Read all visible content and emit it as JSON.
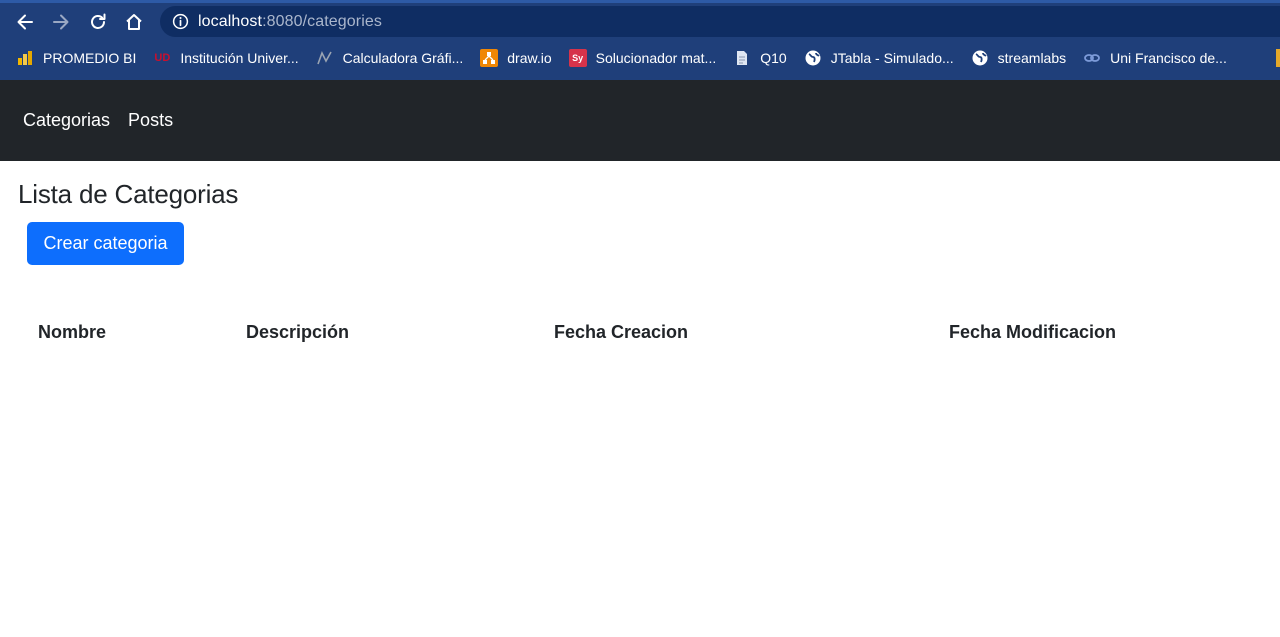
{
  "browser": {
    "url_host": "localhost",
    "url_path": ":8080/categories",
    "bookmarks": [
      {
        "label": "PROMEDIO BI",
        "icon": "bar-chart-icon",
        "color": "#f2b600"
      },
      {
        "label": "Institución Univer...",
        "icon": "university-logo-icon",
        "color": "#c8102e"
      },
      {
        "label": "Calculadora Gráfi...",
        "icon": "graph-icon",
        "color": "#9aa4b2"
      },
      {
        "label": "draw.io",
        "icon": "drawio-icon",
        "color": "#f08705"
      },
      {
        "label": "Solucionador mat...",
        "icon": "symbolab-icon",
        "color": "#d6334b"
      },
      {
        "label": "Q10",
        "icon": "document-icon",
        "color": "#dfe6f2"
      },
      {
        "label": "JTabla - Simulado...",
        "icon": "globe-icon",
        "color": "#ffffff"
      },
      {
        "label": "streamlabs",
        "icon": "globe-icon",
        "color": "#ffffff"
      },
      {
        "label": "Uni Francisco de...",
        "icon": "link-icon",
        "color": "#7d9bd9"
      }
    ]
  },
  "navbar": {
    "items": [
      {
        "label": "Categorias"
      },
      {
        "label": "Posts"
      }
    ]
  },
  "page": {
    "title": "Lista de Categorias",
    "create_button": "Crear categoria"
  },
  "table": {
    "columns": [
      "Nombre",
      "Descripción",
      "Fecha Creacion",
      "Fecha Modificacion"
    ],
    "rows": []
  },
  "colors": {
    "chrome_bg": "#1f3f7a",
    "navbar_bg": "#212529",
    "primary": "#0d6efd"
  }
}
